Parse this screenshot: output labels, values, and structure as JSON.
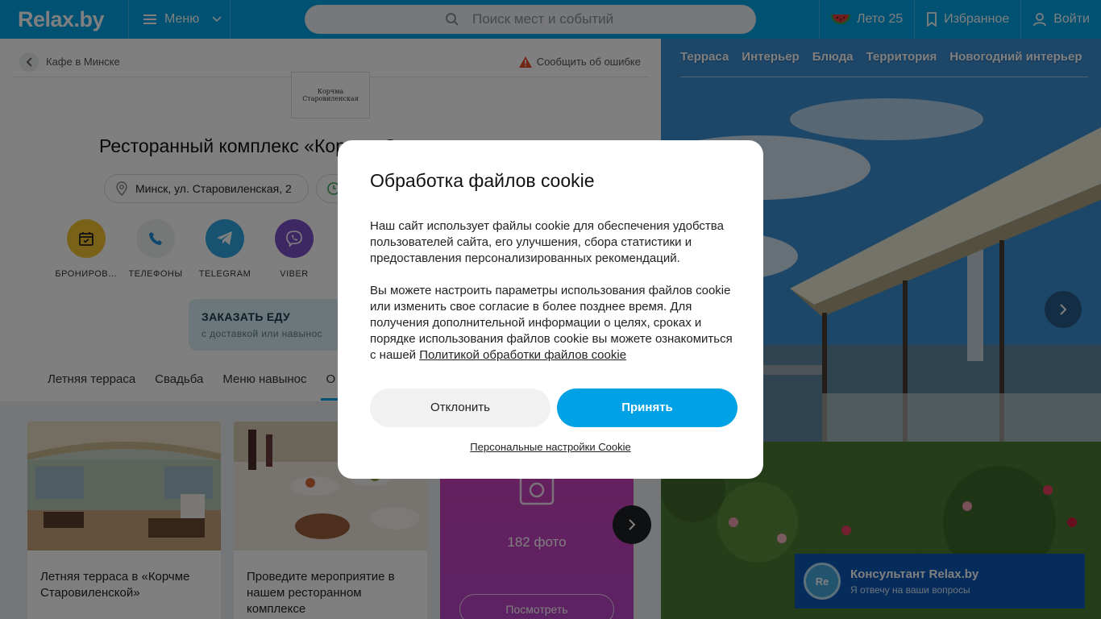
{
  "header": {
    "logo": "Relax.by",
    "menu_label": "Меню",
    "search_placeholder": "Поиск мест и событий",
    "summer_label": "Лето 25",
    "favorites_label": "Избранное",
    "login_label": "Войти"
  },
  "place": {
    "breadcrumb": "Кафе в Минске",
    "report_label": "Сообщить об ошибке",
    "logo_text": "Корчма Старовиленская",
    "title": "Ресторанный комплекс «Корчма Старовиленская»",
    "address": "Минск, ул. Старовиленская, 2",
    "actions": [
      "БРОНИРОВ…",
      "ТЕЛЕФОНЫ",
      "TELEGRAM",
      "VIBER"
    ],
    "order_title": "ЗАКАЗАТЬ ЕДУ",
    "order_sub": "с доставкой или навынос",
    "tabs": [
      "Летняя терраса",
      "Свадьба",
      "Меню навынос",
      "О"
    ]
  },
  "cards": [
    {
      "text": "Летняя терраса в «Корчме Старовиленской»"
    },
    {
      "text": "Проведите мероприятие в нашем ресторанном комплексе"
    }
  ],
  "photos": {
    "count": "182 фото",
    "button": "Посмотреть"
  },
  "gallery": {
    "tabs": [
      "Терраса",
      "Интерьер",
      "Блюда",
      "Территория",
      "Новогодний интерьер"
    ]
  },
  "consultant": {
    "avatar": "Re",
    "title": "Консультант Relax.by",
    "sub": "Я отвечу на ваши вопросы"
  },
  "cookie_modal": {
    "title": "Обработка файлов cookie",
    "p1": "Наш сайт использует файлы cookie для обеспечения удобства пользователей сайта, его улучшения, сбора статистики и предоставления персонализированных рекомендаций.",
    "p2": "Вы можете настроить параметры использования файлов cookie или изменить свое согласие в более позднее время. Для получения дополнительной информации о целях, сроках и порядке использования файлов cookie вы можете ознакомиться с нашей ",
    "link": "Политикой обработки файлов cookie",
    "decline": "Отклонить",
    "accept": "Принять",
    "settings": "Персональные настройки Cookie"
  },
  "colors": {
    "brand": "#00a2e5",
    "booking": "#f2c230",
    "telegram": "#2ea6e0",
    "viber": "#7d50c8",
    "consultant_bg": "#0c58b8"
  }
}
